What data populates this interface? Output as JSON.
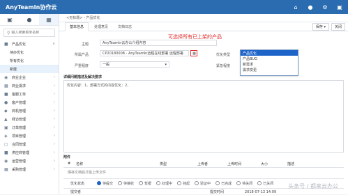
{
  "app": {
    "title": "AnyTeamIn协作云"
  },
  "topbar_icons": [
    "home-icon",
    "user-icon",
    "gear-icon",
    "logout-icon"
  ],
  "sidebar": {
    "tabs": [
      "briefcase-icon",
      "person-icon",
      "grid-icon"
    ],
    "search_placeholder": "输入搜索菜单名称",
    "top_item": "产品优化",
    "sub_items": [
      "待办优化",
      "所有优化",
      "新建"
    ],
    "items": [
      "商业企业",
      "商业需求",
      "客服工单",
      "客户管理",
      "商机管理",
      "拜访管理",
      "订单管理",
      "项目管理",
      "合同管理",
      "供应商管理",
      "运营管理",
      "采购管理"
    ]
  },
  "breadcrumb": "<无标题> - 产品优化",
  "tabs": [
    "基本信息",
    "处理意见",
    "文档日志"
  ],
  "toolbar": {
    "save": "保存",
    "close": "关闭"
  },
  "form": {
    "subject_label": "主题",
    "subject_value": "AnyTeamIn云办公介绍内容",
    "product_label": "所属产品",
    "product_value": "CP20180008 - AnyTeamIn远程在线部署 远程部署",
    "severity_label": "严重程度",
    "severity_value": "一般",
    "opt_type_label": "优化类型",
    "urgency_label": "紧急程度",
    "desc_title": "详细问题描述及解决要求",
    "desc_value": "优化内容：1、部署方式的内容优化：2、"
  },
  "dropdown_options": [
    "产品优化",
    "产品BUG",
    "新需求",
    "需求变更"
  ],
  "annotation": "可选择所有已上架的产品",
  "attachments": {
    "title": "附件",
    "columns": [
      "#",
      "名称",
      "类型",
      "上传者",
      "上传时间",
      "大小",
      "描述"
    ],
    "hint": "保存文档后才能上传文件"
  },
  "status": {
    "label": "优化状态",
    "options": [
      "待提交",
      "待接收",
      "暂缓",
      "处理中",
      "挂起",
      "验证中",
      "已完成",
      "待关闭",
      "已关闭"
    ]
  },
  "footer": {
    "submitter_label": "提交者",
    "submit_time_label": "提交时间",
    "submit_time_value": "2018-07-13 14:09"
  },
  "watermark": "头条号 / 都来云办公"
}
